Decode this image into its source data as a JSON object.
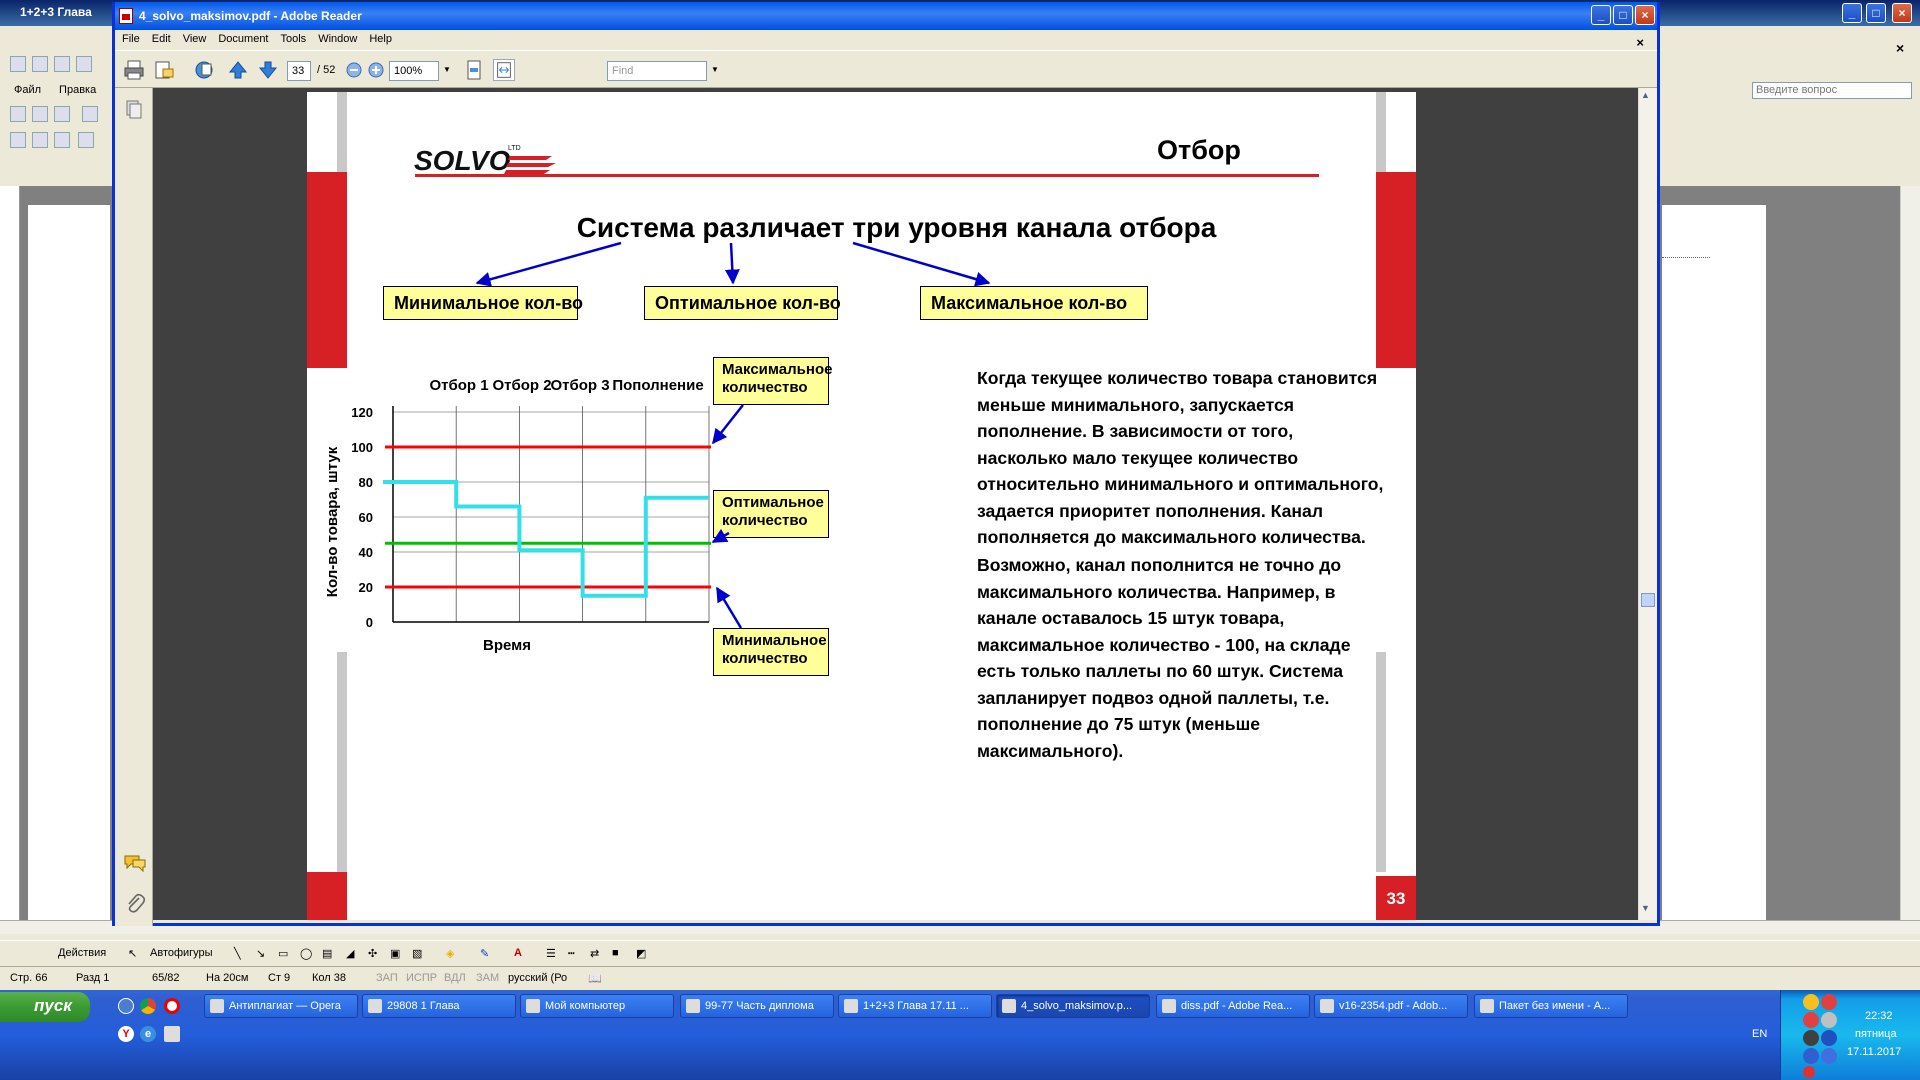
{
  "word": {
    "title": "1+2+3 Глава",
    "menu": [
      "Файл",
      "Правка"
    ],
    "ask_placeholder": "Введите вопрос",
    "drawing_toolbar": {
      "actions": "Действия",
      "autoshapes": "Автофигуры"
    },
    "status": {
      "page": "Стр. 66",
      "section": "Разд 1",
      "pages": "65/82",
      "at": "На 20см",
      "line": "Ст 9",
      "col": "Кол 38",
      "rec": "ЗАП",
      "trk": "ИСПР",
      "ext": "ВДЛ",
      "ovr": "ЗАМ",
      "lang": "русский (Ро"
    }
  },
  "reader": {
    "title": "4_solvo_maksimov.pdf - Adobe Reader",
    "menu": [
      "File",
      "Edit",
      "View",
      "Document",
      "Tools",
      "Window",
      "Help"
    ],
    "page_current": "33",
    "page_total": "/ 52",
    "zoom": "100%",
    "find_placeholder": "Find"
  },
  "slide": {
    "title": "Отбор",
    "logo_text": "SOLVO",
    "logo_ltd": "LTD",
    "heading": "Система различает три уровня канала отбора",
    "boxes": {
      "min": "Минимальное кол-во",
      "opt": "Оптимальное кол-во",
      "max": "Максимальное кол-во"
    },
    "callouts": {
      "max": "Максимальное количество",
      "opt": "Оптимальное количество",
      "min": "Минимальное количество"
    },
    "para1": "Когда текущее количество товара становится меньше минимального, запускается пополнение. В зависимости от того, насколько мало текущее количество относительно минимального и оптимального, задается приоритет пополнения. Канал пополняется до максимального количества.",
    "para2": "Возможно, канал пополнится не точно до максимального количества. Например, в канале оставалось 15 штук товара, максимальное количество - 100, на складе есть только паллеты по 60 штук. Система запланирует подвоз одной паллеты, т.е. пополнение до 75 штук (меньше максимального).",
    "page_number": "33"
  },
  "chart_data": {
    "type": "line",
    "xlabel": "Время",
    "ylabel": "Кол-во товара, штук",
    "ylim": [
      0,
      120
    ],
    "yticks": [
      0,
      20,
      40,
      60,
      80,
      100,
      120
    ],
    "column_labels": [
      "Отбор 1",
      "Отбор 2",
      "Отбор 3",
      "Пополнение"
    ],
    "levels": [
      {
        "name": "Максимальное количество",
        "value": 100,
        "color": "#ff0000"
      },
      {
        "name": "Оптимальное количество",
        "value": 45,
        "color": "#00c000"
      },
      {
        "name": "Минимальное количество",
        "value": 20,
        "color": "#ff0000"
      }
    ],
    "series": [
      {
        "color": "#33e0e8",
        "steps": [
          {
            "from": 0,
            "to": 1,
            "value": 80
          },
          {
            "from": 1,
            "to": 2,
            "value": 66
          },
          {
            "from": 2,
            "to": 3,
            "value": 41
          },
          {
            "from": 3,
            "to": 4,
            "value": 15
          },
          {
            "from": 4,
            "to": 5,
            "value": 71
          }
        ]
      }
    ],
    "grid": true
  },
  "taskbar": {
    "start": "пуск",
    "buttons": [
      "Антиплагиат — Opera",
      "29808 1 Глава",
      "Мой компьютер",
      "99-77 Часть диплома",
      "1+2+3 Глава 17.11 ...",
      "4_solvo_maksimov.p...",
      "diss.pdf - Adobe Rea...",
      "v16-2354.pdf - Adob...",
      "Пакет без имени - A..."
    ],
    "active_index": 5,
    "lang": "EN",
    "time": "22:32",
    "day": "пятница",
    "date": "17.11.2017"
  }
}
